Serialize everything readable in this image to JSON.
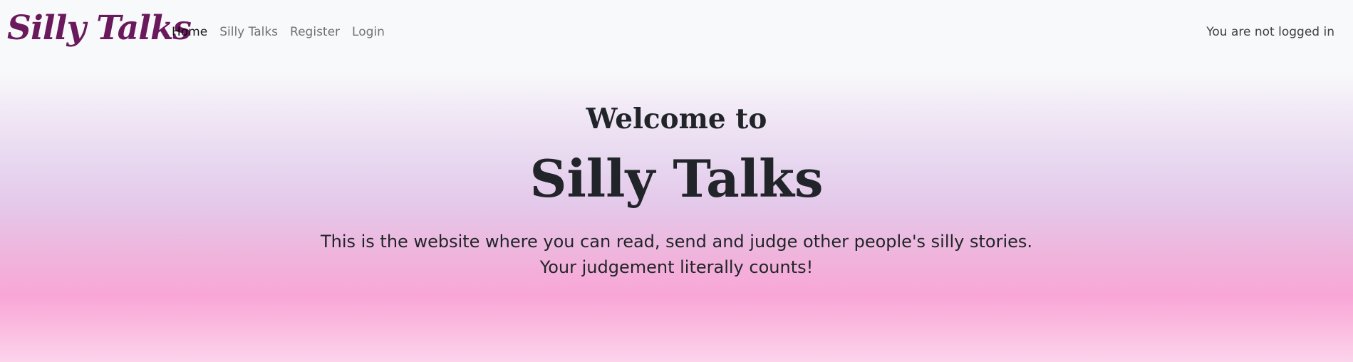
{
  "brand": {
    "name": "Silly Talks",
    "color": "#6a1a5c"
  },
  "nav": {
    "items": [
      {
        "label": "Home",
        "active": true
      },
      {
        "label": "Silly Talks",
        "active": false
      },
      {
        "label": "Register",
        "active": false
      },
      {
        "label": "Login",
        "active": false
      }
    ],
    "status": "You are not logged in"
  },
  "hero": {
    "welcome": "Welcome to",
    "title": "Silly Talks",
    "lead_line1": "This is the website where you can read, send and judge other people's silly stories.",
    "lead_line2": "Your judgement literally counts!"
  }
}
